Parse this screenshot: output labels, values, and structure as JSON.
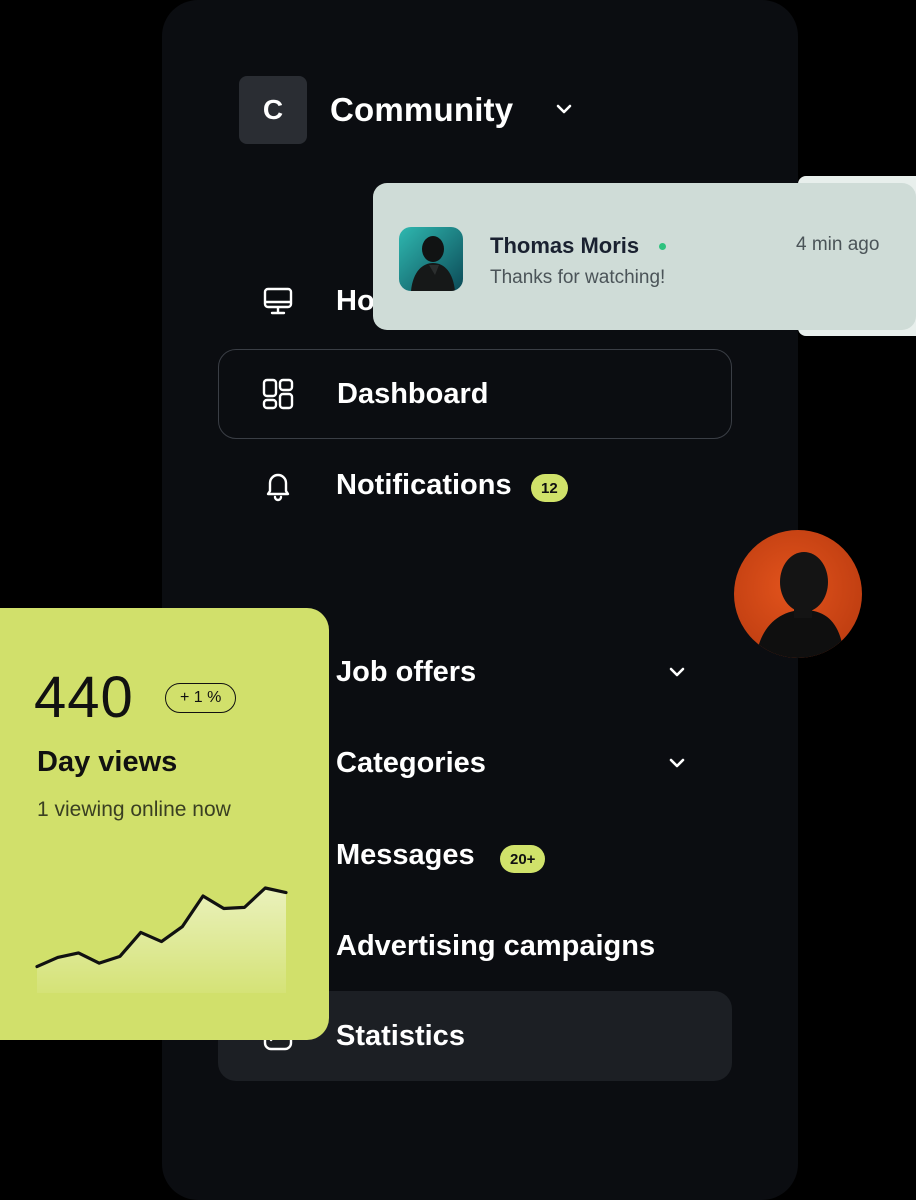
{
  "workspace": {
    "initial": "C",
    "name": "Community"
  },
  "nav": {
    "home": "Home",
    "dashboard": "Dashboard",
    "notifications": "Notifications",
    "notifications_badge": "12",
    "job_offers": "Job offers",
    "categories": "Categories",
    "messages": "Messages",
    "messages_badge": "20+",
    "advertising": "Advertising campaigns",
    "statistics": "Statistics"
  },
  "toast": {
    "name": "Thomas Moris",
    "message": "Thanks for watching!",
    "time": "4 min ago"
  },
  "stats": {
    "value": "440",
    "change": "+ 1 %",
    "title": "Day views",
    "subtitle": "1 viewing online now",
    "sparkline": [
      3,
      11,
      15,
      6,
      12,
      33,
      25,
      38,
      65,
      54,
      55,
      72,
      68
    ]
  },
  "colors": {
    "accent": "#d1e06b",
    "panel": "#0b0d11",
    "online": "#2ec27e"
  }
}
